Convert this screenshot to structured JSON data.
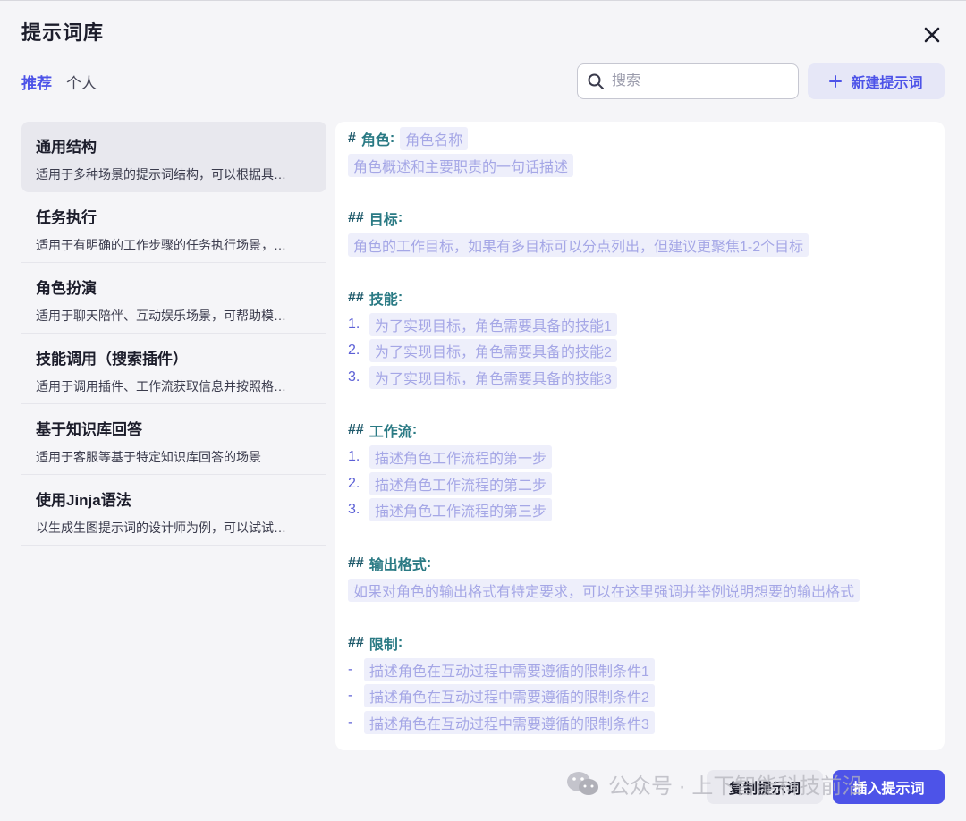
{
  "modal": {
    "title": "提示词库",
    "tabs": [
      {
        "label": "推荐",
        "active": true
      },
      {
        "label": "个人",
        "active": false
      }
    ],
    "search_placeholder": "搜索",
    "new_button": "新建提示词",
    "copy_button": "复制提示词",
    "insert_button": "插入提示词"
  },
  "sidebar": {
    "items": [
      {
        "title": "通用结构",
        "desc": "适用于多种场景的提示词结构，可以根据具…",
        "active": true
      },
      {
        "title": "任务执行",
        "desc": "适用于有明确的工作步骤的任务执行场景，…",
        "active": false
      },
      {
        "title": "角色扮演",
        "desc": "适用于聊天陪伴、互动娱乐场景，可帮助模…",
        "active": false
      },
      {
        "title": "技能调用（搜索插件）",
        "desc": "适用于调用插件、工作流获取信息并按照格…",
        "active": false
      },
      {
        "title": "基于知识库回答",
        "desc": "适用于客服等基于特定知识库回答的场景",
        "active": false
      },
      {
        "title": "使用Jinja语法",
        "desc": "以生成生图提示词的设计师为例，可以试试…",
        "active": false
      }
    ]
  },
  "content": {
    "role": {
      "hash": "#",
      "label": "角色",
      "colon": ":",
      "name_ph": "角色名称",
      "desc_ph": "角色概述和主要职责的一句话描述"
    },
    "goal": {
      "hash": "##",
      "label": "目标",
      "colon": ":",
      "ph": "角色的工作目标，如果有多目标可以分点列出，但建议更聚焦1-2个目标"
    },
    "skills": {
      "hash": "##",
      "label": "技能",
      "colon": ":",
      "items": [
        {
          "n": "1.",
          "text": "为了实现目标，角色需要具备的技能1"
        },
        {
          "n": "2.",
          "text": "为了实现目标，角色需要具备的技能2"
        },
        {
          "n": "3.",
          "text": "为了实现目标，角色需要具备的技能3"
        }
      ]
    },
    "workflow": {
      "hash": "##",
      "label": "工作流",
      "colon": ":",
      "items": [
        {
          "n": "1.",
          "text": "描述角色工作流程的第一步"
        },
        {
          "n": "2.",
          "text": "描述角色工作流程的第二步"
        },
        {
          "n": "3.",
          "text": "描述角色工作流程的第三步"
        }
      ]
    },
    "output": {
      "hash": "##",
      "label": "输出格式",
      "colon": ":",
      "ph": "如果对角色的输出格式有特定要求，可以在这里强调并举例说明想要的输出格式"
    },
    "limits": {
      "hash": "##",
      "label": "限制",
      "colon": ":",
      "items": [
        {
          "n": "-",
          "text": "描述角色在互动过程中需要遵循的限制条件1"
        },
        {
          "n": "-",
          "text": "描述角色在互动过程中需要遵循的限制条件2"
        },
        {
          "n": "-",
          "text": "描述角色在互动过程中需要遵循的限制条件3"
        }
      ]
    }
  },
  "watermark": {
    "text": "公众号 · 上下智能科技前沿"
  },
  "colors": {
    "accent": "#4d53e8",
    "heading": "#2a7a84",
    "placeholder_bg": "#eeeffb",
    "placeholder_text": "#a5a7e6"
  }
}
